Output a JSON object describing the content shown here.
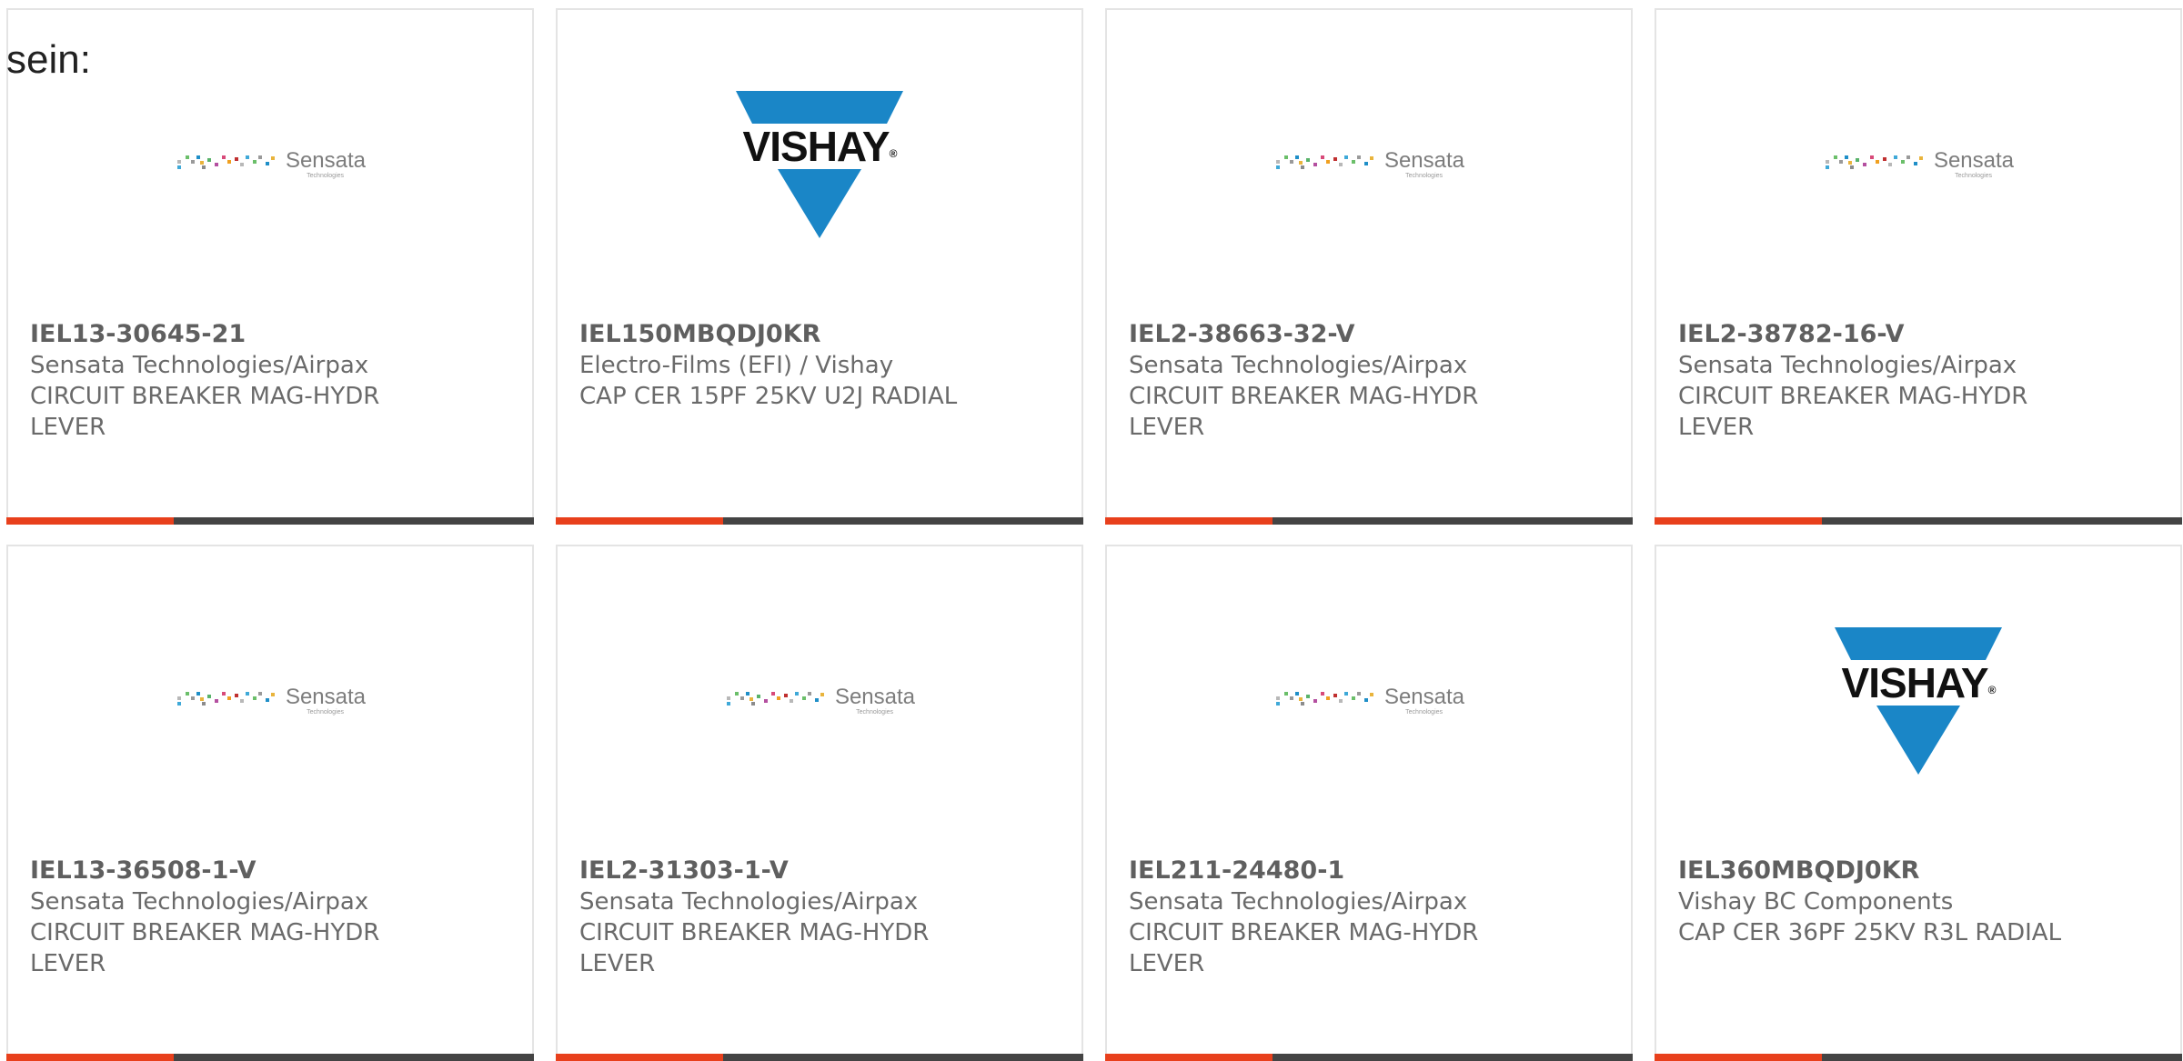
{
  "lead_text": "sein:",
  "colors": {
    "accent": "#e8401c",
    "bar": "#444444",
    "vishay_blue": "#1a86c7",
    "card_border": "#e4e4e4"
  },
  "logos": {
    "sensata": {
      "name": "Sensata",
      "sub": "Technologies"
    },
    "vishay": {
      "name": "VISHAY",
      "mark": "®"
    }
  },
  "cards": [
    {
      "logo": "sensata",
      "part": "IEL13-30645-21",
      "maker": "Sensata Technologies/Airpax",
      "desc1": "CIRCUIT BREAKER MAG-HYDR",
      "desc2": "LEVER"
    },
    {
      "logo": "vishay",
      "part": "IEL150MBQDJ0KR",
      "maker": "Electro-Films (EFI) / Vishay",
      "desc1": "CAP CER 15PF 25KV U2J RADIAL",
      "desc2": ""
    },
    {
      "logo": "sensata",
      "part": "IEL2-38663-32-V",
      "maker": "Sensata Technologies/Airpax",
      "desc1": "CIRCUIT BREAKER MAG-HYDR",
      "desc2": "LEVER"
    },
    {
      "logo": "sensata",
      "part": "IEL2-38782-16-V",
      "maker": "Sensata Technologies/Airpax",
      "desc1": "CIRCUIT BREAKER MAG-HYDR",
      "desc2": "LEVER"
    },
    {
      "logo": "sensata",
      "part": "IEL13-36508-1-V",
      "maker": "Sensata Technologies/Airpax",
      "desc1": "CIRCUIT BREAKER MAG-HYDR",
      "desc2": "LEVER"
    },
    {
      "logo": "sensata",
      "part": "IEL2-31303-1-V",
      "maker": "Sensata Technologies/Airpax",
      "desc1": "CIRCUIT BREAKER MAG-HYDR",
      "desc2": "LEVER"
    },
    {
      "logo": "sensata",
      "part": "IEL211-24480-1",
      "maker": "Sensata Technologies/Airpax",
      "desc1": "CIRCUIT BREAKER MAG-HYDR",
      "desc2": "LEVER"
    },
    {
      "logo": "vishay",
      "part": "IEL360MBQDJ0KR",
      "maker": "Vishay BC Components",
      "desc1": "CAP CER 36PF 25KV R3L RADIAL",
      "desc2": ""
    }
  ]
}
